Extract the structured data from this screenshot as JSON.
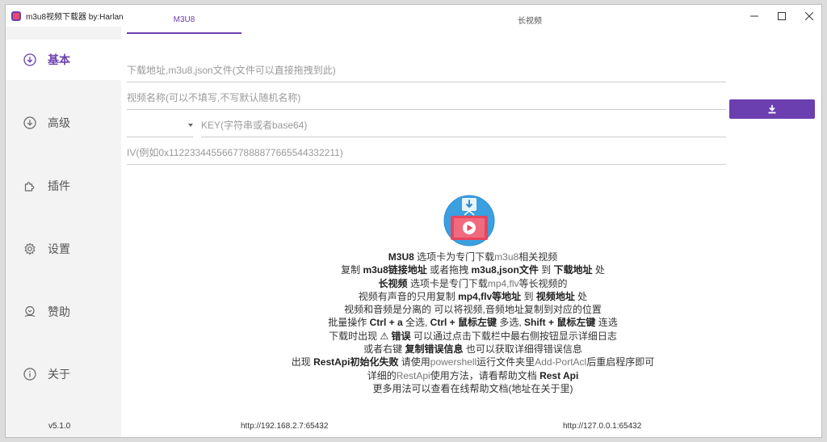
{
  "window": {
    "title": "m3u8视频下载器 by:Harlan",
    "controls": {
      "minimize": "–",
      "maximize": "☐",
      "close": "✕"
    }
  },
  "sidebar": {
    "items": [
      {
        "label": "基本",
        "icon": "download-circle-icon",
        "active": true
      },
      {
        "label": "高级",
        "icon": "download-circle-icon",
        "active": false
      },
      {
        "label": "插件",
        "icon": "puzzle-icon",
        "active": false
      },
      {
        "label": "设置",
        "icon": "gear-icon",
        "active": false
      },
      {
        "label": "赞助",
        "icon": "sponsor-icon",
        "active": false
      },
      {
        "label": "关于",
        "icon": "info-icon",
        "active": false
      }
    ],
    "version": "v5.1.0"
  },
  "tabs": [
    {
      "label": "M3U8",
      "active": true
    },
    {
      "label": "长视频",
      "active": false
    }
  ],
  "form": {
    "url_placeholder": "下载地址,m3u8,json文件(文件可以直接拖拽到此)",
    "name_placeholder": "视频名称(可以不填写,不写默认随机名称)",
    "method_value": "",
    "key_placeholder": "KEY(字符串或者base64)",
    "iv_placeholder": "IV(例如0x11223344556677888877665544332211)"
  },
  "help_lines": [
    [
      {
        "t": "M3U8",
        "b": true
      },
      {
        "t": " 选项卡为专门下载"
      },
      {
        "t": "m3u8",
        "l": true
      },
      {
        "t": "相关视频"
      }
    ],
    [
      {
        "t": "复制 "
      },
      {
        "t": "m3u8链接地址",
        "b": true
      },
      {
        "t": " 或者拖拽 "
      },
      {
        "t": "m3u8,json文件",
        "b": true
      },
      {
        "t": " 到 "
      },
      {
        "t": "下载地址",
        "b": true
      },
      {
        "t": " 处"
      }
    ],
    [
      {
        "t": "长视频",
        "b": true
      },
      {
        "t": " 选项卡是专门下载"
      },
      {
        "t": "mp4,flv",
        "l": true
      },
      {
        "t": "等长视频的"
      }
    ],
    [
      {
        "t": "视频有声音的只用复制 "
      },
      {
        "t": "mp4,flv等地址",
        "b": true
      },
      {
        "t": " 到 "
      },
      {
        "t": "视频地址",
        "b": true
      },
      {
        "t": " 处"
      }
    ],
    [
      {
        "t": "视频和音频是分离的 可以将视频,音频地址复制到对应的位置"
      }
    ],
    [
      {
        "t": "批量操作 "
      },
      {
        "t": "Ctrl + a",
        "b": true
      },
      {
        "t": " 全选, "
      },
      {
        "t": "Ctrl + 鼠标左键",
        "b": true
      },
      {
        "t": " 多选, "
      },
      {
        "t": "Shift + 鼠标左键",
        "b": true
      },
      {
        "t": " 连选"
      }
    ],
    [
      {
        "t": "下载时出现 "
      },
      {
        "t": "⚠",
        "b": true
      },
      {
        "t": " "
      },
      {
        "t": "错误",
        "b": true
      },
      {
        "t": " 可以通过点击下载栏中最右侧按钮显示详细日志"
      }
    ],
    [
      {
        "t": "或者右键 "
      },
      {
        "t": "复制错误信息",
        "b": true
      },
      {
        "t": " 也可以获取详细得错误信息"
      }
    ],
    [
      {
        "t": "出现 "
      },
      {
        "t": "RestApi初始化失败",
        "b": true
      },
      {
        "t": " 请使用"
      },
      {
        "t": "powershell",
        "l": true
      },
      {
        "t": "运行文件夹里"
      },
      {
        "t": "Add-PortAcl",
        "l": true
      },
      {
        "t": "后重启程序即可"
      }
    ],
    [
      {
        "t": "详细的"
      },
      {
        "t": "RestApi",
        "l": true
      },
      {
        "t": "使用方法，请看帮助文档 "
      },
      {
        "t": "Rest Api",
        "b": true
      }
    ],
    [
      {
        "t": "更多用法可以查看在线帮助文档(地址在关于里)"
      }
    ]
  ],
  "footer": {
    "left_url": "http://192.168.2.7:65432",
    "right_url": "http://127.0.0.1:65432"
  },
  "colors": {
    "accent": "#6b3fb0"
  }
}
